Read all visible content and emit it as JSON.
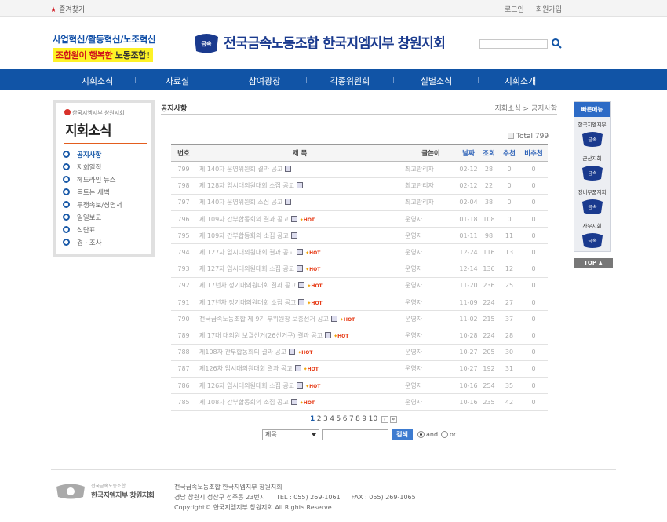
{
  "topbar": {
    "favorite": "즐겨찾기",
    "login": "로그인",
    "join": "회원가입"
  },
  "header": {
    "slogan1": "사업혁신/활동혁신/노조혁신",
    "slogan2_hl": "조합원이 행복한",
    "slogan2_rest": " 노동조합!",
    "org": "전국금속노동조합 한국지엠지부 창원지회",
    "logo_text": "금속"
  },
  "nav": [
    "지회소식",
    "자료실",
    "참여광장",
    "각종위원회",
    "실별소식",
    "지회소개"
  ],
  "sidebar": {
    "org": "한국지엠지부 창원지회",
    "title": "지회소식",
    "items": [
      "공지사항",
      "지회일정",
      "헤드라인 뉴스",
      "돋트는 새벽",
      "투쟁속보/성명서",
      "일일보고",
      "식단표",
      "경 · 조사"
    ]
  },
  "content": {
    "title": "공지사항",
    "breadcrumb": "지회소식 > 공지사항",
    "total": "Total 799"
  },
  "table": {
    "headers": [
      "번호",
      "제 목",
      "글쓴이",
      "날짜",
      "조회",
      "추천",
      "비추천"
    ],
    "rows": [
      {
        "num": "799",
        "subject": "제 140차 운영위원회 결과 공고",
        "hot": false,
        "writer": "최고관리자",
        "date": "02-12",
        "views": "28",
        "rec": "0",
        "nrec": "0"
      },
      {
        "num": "798",
        "subject": "제 128차 임시대의원대회 소집 공고",
        "hot": false,
        "writer": "최고관리자",
        "date": "02-12",
        "views": "22",
        "rec": "0",
        "nrec": "0"
      },
      {
        "num": "797",
        "subject": "제 140차 운영위원회 소집 공고",
        "hot": false,
        "writer": "최고관리자",
        "date": "02-04",
        "views": "38",
        "rec": "0",
        "nrec": "0"
      },
      {
        "num": "796",
        "subject": "제 109차 간부합동회의 결과 공고",
        "hot": true,
        "writer": "운영자",
        "date": "01-18",
        "views": "108",
        "rec": "0",
        "nrec": "0"
      },
      {
        "num": "795",
        "subject": "제 109차 간부합동회의 소집 공고",
        "hot": false,
        "writer": "운영자",
        "date": "01-11",
        "views": "98",
        "rec": "11",
        "nrec": "0"
      },
      {
        "num": "794",
        "subject": "제 127차 임시대의원대회 결과 공고",
        "hot": true,
        "writer": "운영자",
        "date": "12-24",
        "views": "116",
        "rec": "13",
        "nrec": "0"
      },
      {
        "num": "793",
        "subject": "제 127차 임시대의원대회 소집 공고",
        "hot": true,
        "writer": "운영자",
        "date": "12-14",
        "views": "136",
        "rec": "12",
        "nrec": "0"
      },
      {
        "num": "792",
        "subject": "제 17년차 정기대의원대회 결과 공고",
        "hot": true,
        "writer": "운영자",
        "date": "11-20",
        "views": "236",
        "rec": "25",
        "nrec": "0"
      },
      {
        "num": "791",
        "subject": "제 17년차 정기대의원대회 소집 공고",
        "hot": true,
        "writer": "운영자",
        "date": "11-09",
        "views": "224",
        "rec": "27",
        "nrec": "0"
      },
      {
        "num": "790",
        "subject": "전국금속노동조합 제 9기 부위원장 보충선거 공고",
        "hot": true,
        "writer": "운영자",
        "date": "11-02",
        "views": "215",
        "rec": "37",
        "nrec": "0"
      },
      {
        "num": "789",
        "subject": "제 17대 대의원 보궐선거(26선거구) 결과 공고",
        "hot": true,
        "writer": "운영자",
        "date": "10-28",
        "views": "224",
        "rec": "28",
        "nrec": "0"
      },
      {
        "num": "788",
        "subject": "제108차 간부합동회의 결과 공고",
        "hot": true,
        "writer": "운영자",
        "date": "10-27",
        "views": "205",
        "rec": "30",
        "nrec": "0"
      },
      {
        "num": "787",
        "subject": "제126차 임시대의원대회 결과 공고",
        "hot": true,
        "writer": "운영자",
        "date": "10-27",
        "views": "192",
        "rec": "31",
        "nrec": "0"
      },
      {
        "num": "786",
        "subject": "제 126차 임시대의원대회 소집 공고",
        "hot": true,
        "writer": "운영자",
        "date": "10-16",
        "views": "254",
        "rec": "35",
        "nrec": "0"
      },
      {
        "num": "785",
        "subject": "제 108차 간부합동회의 소집 공고",
        "hot": true,
        "writer": "운영자",
        "date": "10-16",
        "views": "235",
        "rec": "42",
        "nrec": "0"
      }
    ]
  },
  "pager": [
    "1",
    "2",
    "3",
    "4",
    "5",
    "6",
    "7",
    "8",
    "9",
    "10"
  ],
  "search": {
    "field": "제목",
    "button": "검색",
    "and": "and",
    "or": "or"
  },
  "quick": {
    "title": "빠른메뉴",
    "items": [
      "한국지엠지부",
      "군산지회",
      "정비부품지회",
      "사무지회"
    ],
    "top": "TOP ▲"
  },
  "footer": {
    "small": "전국금속노동조합",
    "org": "한국지엠지부 창원지회",
    "line1": "전국금속노동조합 한국지엠지부 창원지회",
    "address": "경남 창원시 성산구 성주동 23번지",
    "tel": "TEL : 055) 269-1061",
    "fax": "FAX : 055) 269-1065",
    "copyright": "Copyright© 한국지엠지부 창원지회 All Rights Reserve."
  },
  "colors": {
    "nav": "#1154a6",
    "accent": "#e35d1e",
    "hot": "#e63b17"
  }
}
